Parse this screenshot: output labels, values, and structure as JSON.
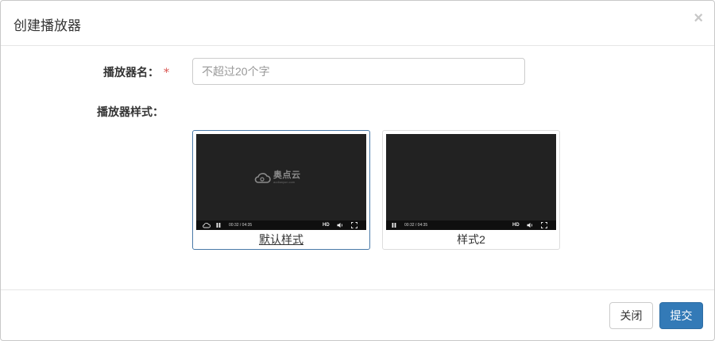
{
  "modal": {
    "title": "创建播放器",
    "close_glyph": "×"
  },
  "form": {
    "name_label": "播放器名：",
    "required_mark": "*",
    "name_placeholder": "不超过20个字",
    "name_value": "",
    "style_label": "播放器样式："
  },
  "styles": [
    {
      "label": "默认样式",
      "selected": true,
      "logo_text": "奥点云",
      "logo_sub": "aodianyun.com",
      "time": "00:32 / 04:35",
      "hd": "HD"
    },
    {
      "label": "样式2",
      "selected": false,
      "time": "00:32 / 04:35",
      "hd": "HD"
    }
  ],
  "footer": {
    "close_label": "关闭",
    "submit_label": "提交"
  },
  "colors": {
    "primary": "#337ab7",
    "required": "#d9534f",
    "selected_border": "#4a7aa8",
    "player_bg": "#222222"
  },
  "icons": [
    "close-icon",
    "cloud-icon",
    "pause-icon",
    "volume-icon",
    "fullscreen-icon"
  ]
}
